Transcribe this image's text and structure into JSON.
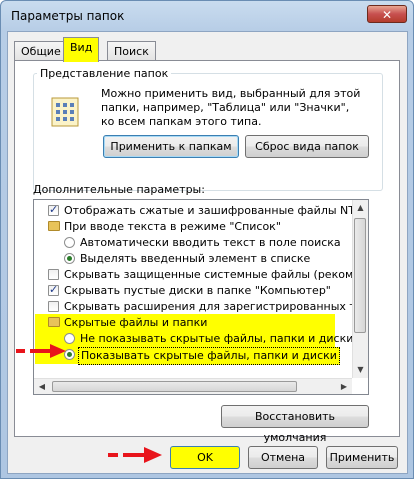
{
  "window": {
    "title": "Параметры папок",
    "close_label": "✕"
  },
  "tabs": [
    {
      "label": "Общие"
    },
    {
      "label": "Вид"
    },
    {
      "label": "Поиск"
    }
  ],
  "folder_view": {
    "group_label": "Представление папок",
    "description_lines": [
      "Можно применить вид, выбранный для этой",
      "папки, например, \"Таблица\" или \"Значки\",",
      "ко всем папкам этого типа."
    ],
    "apply_button": "Применить к папкам",
    "reset_button": "Сброс вида папок"
  },
  "advanced": {
    "label": "Дополнительные параметры:",
    "items": [
      {
        "kind": "checkbox",
        "checked": true,
        "text": "Отображать сжатые и зашифрованные файлы NTI"
      },
      {
        "kind": "folder",
        "text": "При вводе текста в режиме \"Список\""
      },
      {
        "kind": "radio",
        "checked": false,
        "text": "Автоматически вводить текст в поле поиска"
      },
      {
        "kind": "radio",
        "checked": true,
        "text": "Выделять введенный элемент в списке"
      },
      {
        "kind": "checkbox",
        "checked": false,
        "text": "Скрывать защищенные системные файлы (рекомен"
      },
      {
        "kind": "checkbox",
        "checked": true,
        "text": "Скрывать пустые диски в папке \"Компьютер\""
      },
      {
        "kind": "checkbox",
        "checked": false,
        "text": "Скрывать расширения для зарегистрированных типо"
      },
      {
        "kind": "folder",
        "text": "Скрытые файлы и папки"
      },
      {
        "kind": "radio",
        "checked": false,
        "text": "Не показывать скрытые файлы, папки и диски"
      },
      {
        "kind": "radio",
        "checked": true,
        "text": "Показывать скрытые файлы, папки и диски"
      }
    ],
    "restore_button": "Восстановить умолчания"
  },
  "footer": {
    "ok": "OK",
    "cancel": "Отмена",
    "apply": "Применить"
  },
  "colors": {
    "highlight": "#ffff00",
    "arrow": "#e8141b"
  }
}
